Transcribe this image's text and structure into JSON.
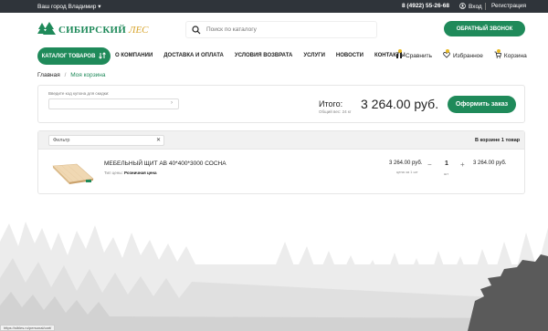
{
  "topbar": {
    "city": "Ваш город Владимир",
    "phone": "8 (4922) 55-26-68",
    "login": "Вход",
    "register": "Регистрация"
  },
  "logo": {
    "word1": "СИБИРСКИЙ",
    "word2": "ЛЕС"
  },
  "search": {
    "placeholder": "Поиск по каталогу"
  },
  "callback_label": "ОБРАТНЫЙ ЗВОНОК",
  "catalog_label": "КАТАЛОГ ТОВАРОВ",
  "nav": [
    "О КОМПАНИИ",
    "ДОСТАВКА И ОПЛАТА",
    "УСЛОВИЯ ВОЗВРАТА",
    "УСЛУГИ",
    "НОВОСТИ",
    "КОНТАКТЫ"
  ],
  "nav_right": {
    "compare": "Сравнить",
    "favorites": "Избранное",
    "cart": "Корзина"
  },
  "breadcrumb": {
    "home": "Главная",
    "sep": "/",
    "current": "Моя корзина"
  },
  "coupon": {
    "label": "Введите код купона для скидки:"
  },
  "summary": {
    "total_label": "Итого:",
    "weight": "Общий вес: 24 кг",
    "sum": "3 264.00 руб.",
    "order_button": "Оформить заказ"
  },
  "cart": {
    "filter_placeholder": "Фильтр",
    "count": "В корзине 1 товар",
    "items": [
      {
        "name": "МЕБЕЛЬНЫЙ ЩИТ АВ 40*400*3000 СОСНА",
        "price_type_label": "Тип цены:",
        "price_type": "Розничная цена",
        "unit_price": "3 264.00 руб.",
        "unit_price_sub": "цена за 1 шт",
        "quantity": "1",
        "unit": "шт",
        "line_total": "3 264.00 руб."
      }
    ]
  },
  "status_url": "https://sibles.ru/personal/cart/",
  "colors": {
    "brand_green": "#1f8a5a",
    "accent_yellow": "#e8b923",
    "topbar": "#2f343a"
  }
}
